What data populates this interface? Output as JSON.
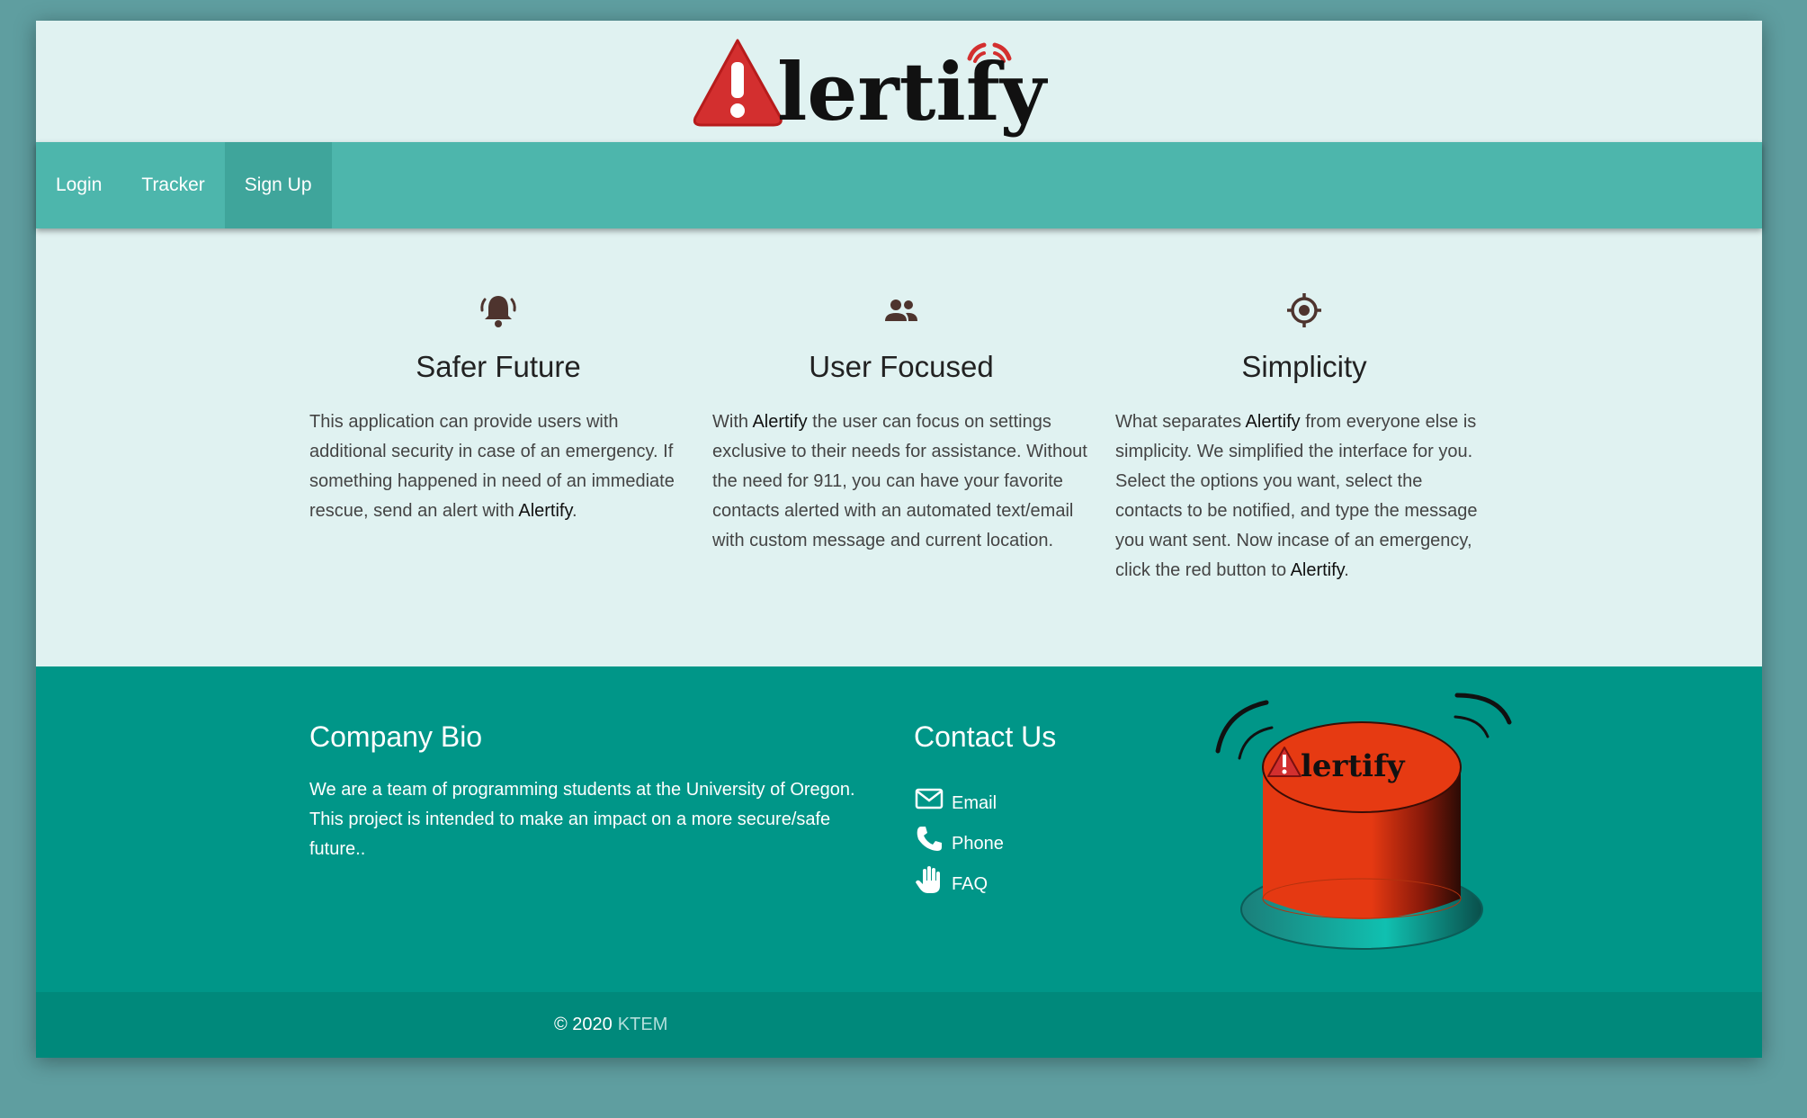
{
  "brand": {
    "logo_text": "lertify",
    "colors": {
      "alert_red": "#d32f2f",
      "logo_text": "#111111"
    }
  },
  "nav": {
    "items": [
      {
        "label": "Login",
        "active": false
      },
      {
        "label": "Tracker",
        "active": false
      },
      {
        "label": "Sign Up",
        "active": true
      }
    ],
    "color": "#4db6ac"
  },
  "features": [
    {
      "icon": "bell-alert-icon",
      "title": "Safer Future",
      "text_before": "This application can provide users with additional security in case of an emergency. If something happened in need of an immediate rescue, send an alert with ",
      "brand": "Alertify",
      "text_after": "."
    },
    {
      "icon": "users-icon",
      "title": "User Focused",
      "text_before": "With ",
      "brand": "Alertify",
      "text_after": " the user can focus on settings exclusive to their needs for assistance. Without the need for 911, you can have your favorite contacts alerted with an automated text/email with custom message and current location."
    },
    {
      "icon": "target-icon",
      "title": "Simplicity",
      "text_before": "What separates ",
      "brand": "Alertify",
      "text_mid": " from everyone else is simplicity. We simplified the interface for you. Select the options you want, select the contacts to be notified, and type the message you want sent. Now incase of an emergency, click the red button to ",
      "brand2": "Alertify",
      "text_after": "."
    }
  ],
  "footer": {
    "bio_title": "Company Bio",
    "bio_text": "We are a team of programming students at the University of Oregon. This project is intended to make an impact on a more secure/safe future..",
    "contact_title": "Contact Us",
    "contacts": [
      {
        "icon": "envelope-icon",
        "label": "Email"
      },
      {
        "icon": "phone-icon",
        "label": "Phone"
      },
      {
        "icon": "hand-icon",
        "label": "FAQ"
      }
    ],
    "button_logo_text": "lertify",
    "color": "#009688"
  },
  "copyright": {
    "prefix": "© 2020",
    "owner": "KTEM"
  }
}
